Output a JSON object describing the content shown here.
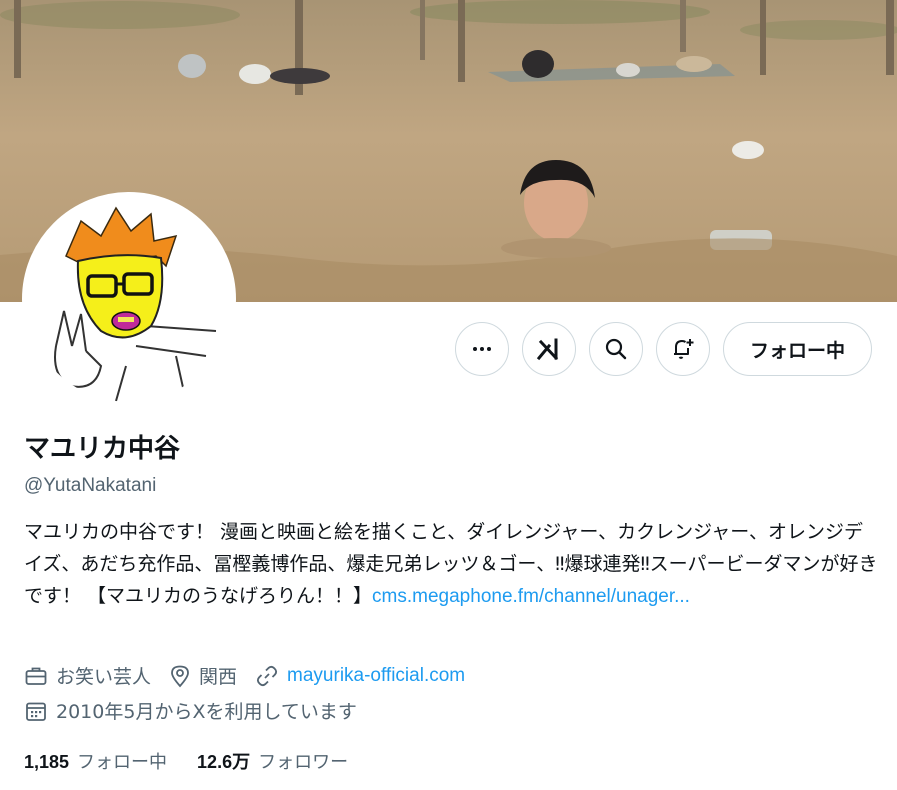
{
  "profile": {
    "name": "マユリカ中谷",
    "handle": "@YutaNakatani",
    "bio_text": "マユリカの中谷です！ 漫画と映画と絵を描くこと、ダイレンジャー、カクレンジャー、オレンジデイズ、あだち充作品、冨樫義博作品、爆走兄弟レッツ＆ゴー、‼爆球連発‼スーパービーダマンが好きです！ 【マユリカのうなげろりん！！】",
    "bio_link": "cms.megaphone.fm/channel/unager...",
    "category": "お笑い芸人",
    "location": "関西",
    "website": "mayurika-official.com",
    "joined": "2010年5月からXを利用しています"
  },
  "actions": {
    "follow_label": "フォロー中"
  },
  "stats": {
    "following_count": "1,185",
    "following_label": "フォロー中",
    "followers_count": "12.6万",
    "followers_label": "フォロワー"
  },
  "colors": {
    "link": "#1d9bf0",
    "secondary_text": "#536471",
    "border": "#cfd9de",
    "avatar_face": "#f5ef1a"
  }
}
